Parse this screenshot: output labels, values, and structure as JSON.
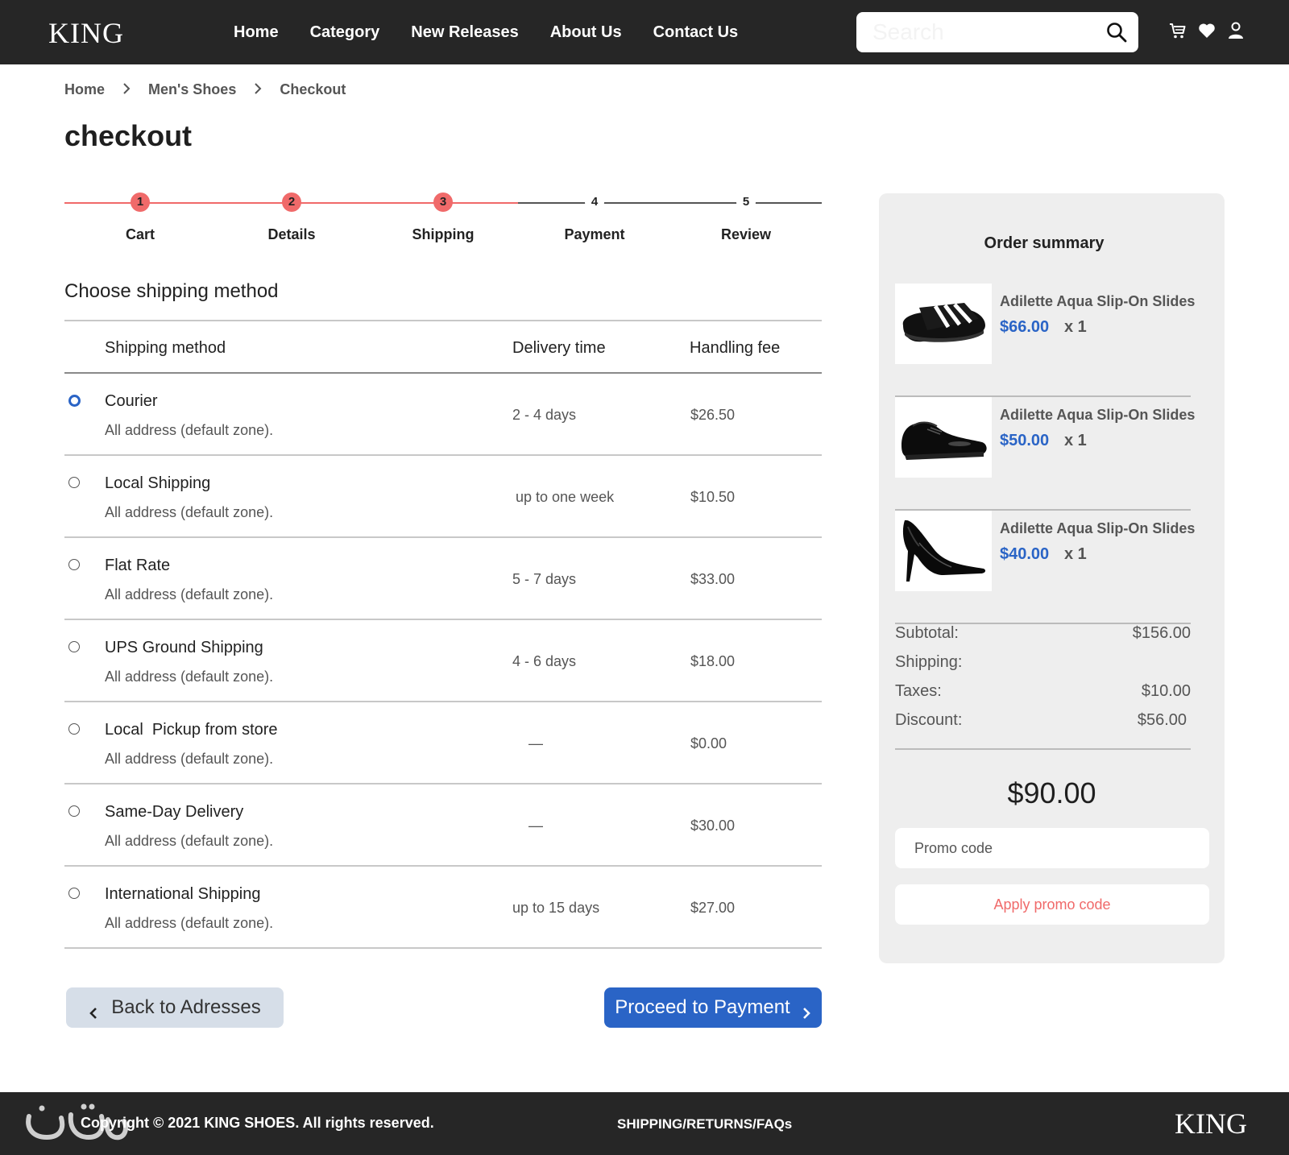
{
  "header": {
    "logo": "KING",
    "nav": [
      "Home",
      "Category",
      "New Releases",
      "About Us",
      "Contact Us"
    ],
    "search_placeholder": "Search",
    "icons": [
      "cart-icon",
      "heart-icon",
      "user-icon",
      "search-icon"
    ]
  },
  "breadcrumb": [
    "Home",
    "Men's Shoes",
    "Checkout"
  ],
  "page_title": "checkout",
  "steps": [
    {
      "num": "1",
      "label": "Cart",
      "done": true
    },
    {
      "num": "2",
      "label": "Details",
      "done": true
    },
    {
      "num": "3",
      "label": "Shipping",
      "done": true
    },
    {
      "num": "4",
      "label": "Payment",
      "done": false
    },
    {
      "num": "5",
      "label": "Review",
      "done": false
    }
  ],
  "section_title": "Choose shipping method",
  "table": {
    "headers": {
      "method": "Shipping method",
      "time": "Delivery time",
      "fee": "Handling fee"
    },
    "rows": [
      {
        "name": "Courier",
        "zone": "All address (default zone).",
        "time": "2 - 4 days",
        "fee": "$26.50",
        "selected": true
      },
      {
        "name": "Local Shipping",
        "zone": "All address (default zone).",
        "time": "up to one week",
        "fee": "$10.50",
        "selected": false
      },
      {
        "name": "Flat Rate",
        "zone": "All address (default zone).",
        "time": "5 - 7 days",
        "fee": "$33.00",
        "selected": false
      },
      {
        "name": "UPS Ground Shipping",
        "zone": "All address (default zone).",
        "time": "4 - 6 days",
        "fee": "$18.00",
        "selected": false
      },
      {
        "name": "Local  Pickup from store",
        "zone": "All address (default zone).",
        "time": "—",
        "fee": "$0.00",
        "selected": false
      },
      {
        "name": "Same-Day Delivery",
        "zone": "All address (default zone).",
        "time": "—",
        "fee": "$30.00",
        "selected": false
      },
      {
        "name": "International Shipping",
        "zone": "All address (default zone).",
        "time": "up to 15 days",
        "fee": "$27.00",
        "selected": false
      }
    ]
  },
  "buttons": {
    "back": "Back to Adresses",
    "next": "Proceed to Payment"
  },
  "summary": {
    "title": "Order summary",
    "items": [
      {
        "name": "Adilette Aqua Slip-On Slides",
        "price": "$66.00",
        "qty": "x 1",
        "image": "slide-sandal-image"
      },
      {
        "name": "Adilette Aqua Slip-On Slides",
        "price": "$50.00",
        "qty": "x 1",
        "image": "oxford-shoe-image"
      },
      {
        "name": "Adilette Aqua Slip-On Slides",
        "price": "$40.00",
        "qty": "x 1",
        "image": "high-heel-image"
      }
    ],
    "totals": [
      {
        "label": "Subtotal:",
        "value": "$156.00"
      },
      {
        "label": "Shipping:",
        "value": ""
      },
      {
        "label": "Taxes:",
        "value": "$10.00"
      },
      {
        "label": "Discount:",
        "value": "$56.00"
      }
    ],
    "grand_total": "$90.00",
    "promo_placeholder": "Promo code",
    "promo_button": "Apply promo code"
  },
  "footer": {
    "copyright": "Copyright © 2021 KING SHOES. All rights reserved.",
    "links": "SHIPPING/RETURNS/FAQs",
    "logo": "KING"
  },
  "colors": {
    "header_bg": "#262626",
    "accent_red": "#f06a6a",
    "primary_blue": "#2a64c6"
  }
}
